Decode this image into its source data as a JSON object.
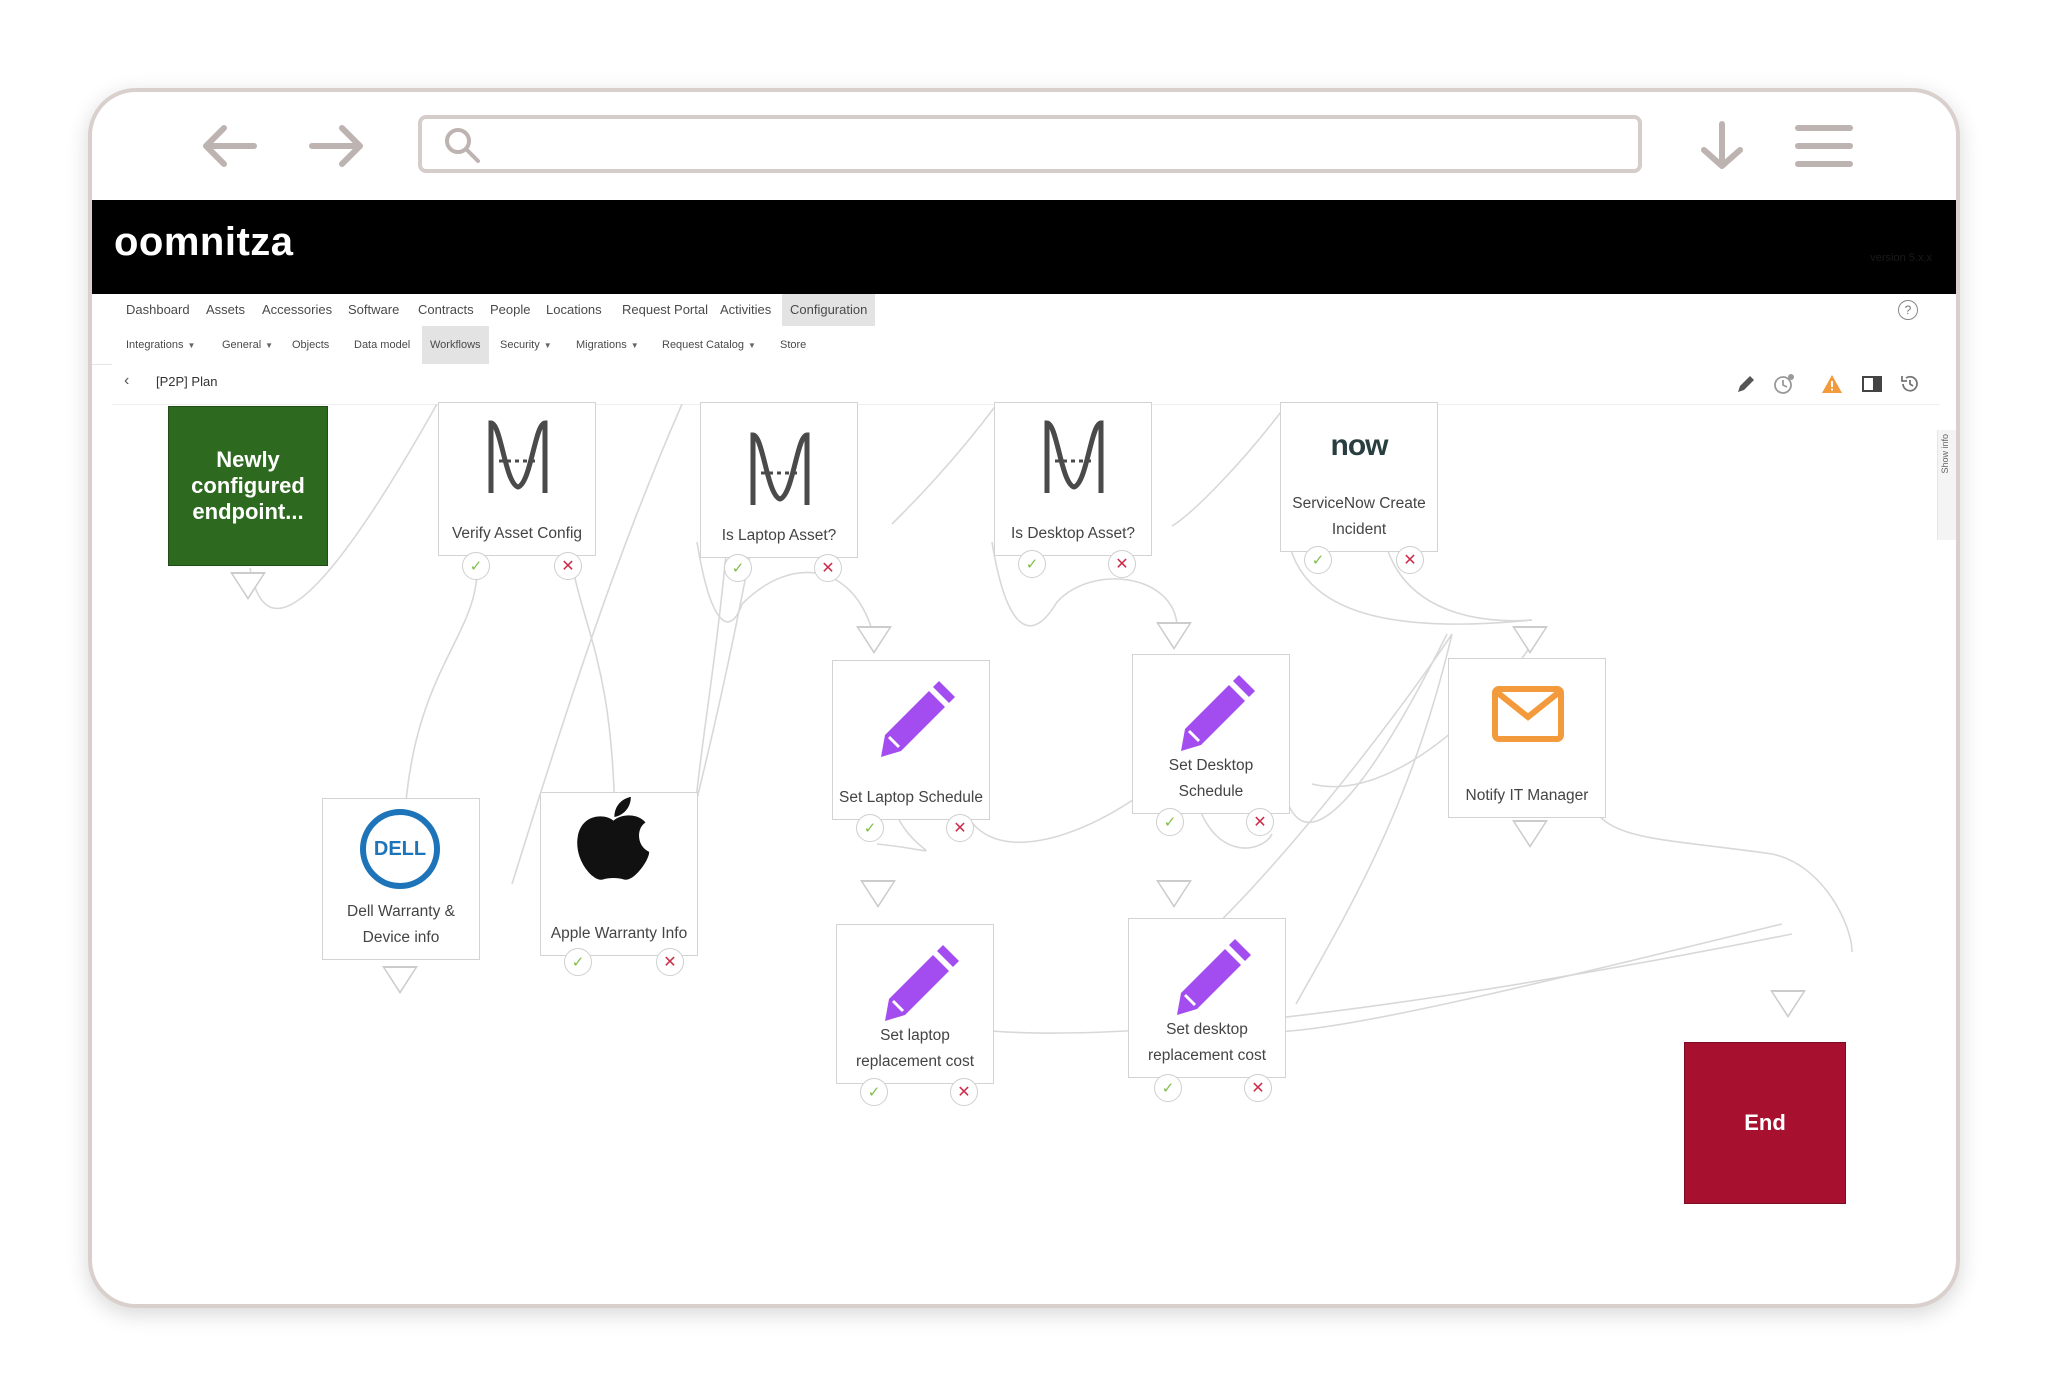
{
  "browser": {
    "search_value": "",
    "icons": [
      "back-arrow-icon",
      "forward-arrow-icon",
      "search-icon",
      "download-icon",
      "hamburger-menu-icon"
    ]
  },
  "app": {
    "logo": "oomnitza",
    "version": "version 5.x.x"
  },
  "primary_nav": [
    "Dashboard",
    "Assets",
    "Accessories",
    "Software",
    "Contracts",
    "People",
    "Locations",
    "Request Portal",
    "Activities",
    "Configuration"
  ],
  "primary_active": "Configuration",
  "secondary_nav": [
    {
      "label": "Integrations",
      "dropdown": true
    },
    {
      "label": "General",
      "dropdown": true
    },
    {
      "label": "Objects",
      "dropdown": false
    },
    {
      "label": "Data model",
      "dropdown": false
    },
    {
      "label": "Workflows",
      "dropdown": false
    },
    {
      "label": "Security",
      "dropdown": true
    },
    {
      "label": "Migrations",
      "dropdown": true
    },
    {
      "label": "Request Catalog",
      "dropdown": true
    },
    {
      "label": "Store",
      "dropdown": false
    }
  ],
  "secondary_active": "Workflows",
  "breadcrumb": {
    "title": "[P2P] Plan"
  },
  "side_tab": "Show info",
  "toolbar_icons": [
    "edit-pencil-icon",
    "settings-clock-icon",
    "warning-icon",
    "panel-toggle-icon",
    "history-icon"
  ],
  "colors": {
    "start_block": "#2d6a1f",
    "end_block": "#a8102f",
    "check": "#7fbf4a",
    "cross": "#cc2d4a",
    "pencil": "#a34cf0",
    "mail": "#f29a3c",
    "dell": "#1e74b8",
    "servicenow_o": "#62d84e"
  },
  "workflow": {
    "start_label": "Newly configured endpoint...",
    "end_label": "End",
    "nodes": {
      "verify_asset_config": "Verify Asset Config",
      "is_laptop_asset": "Is Laptop Asset?",
      "is_desktop_asset": "Is Desktop Asset?",
      "servicenow_incident": "ServiceNow Create Incident",
      "servicenow_logo": "now",
      "dell_warranty": "Dell Warranty & Device info",
      "dell_logo": "DELL",
      "apple_warranty": "Apple Warranty Info",
      "set_laptop_schedule": "Set Laptop Schedule",
      "set_desktop_schedule": "Set Desktop Schedule",
      "notify_it_manager": "Notify IT Manager",
      "set_laptop_cost": "Set laptop replacement cost",
      "set_desktop_cost": "Set desktop replacement cost"
    }
  }
}
